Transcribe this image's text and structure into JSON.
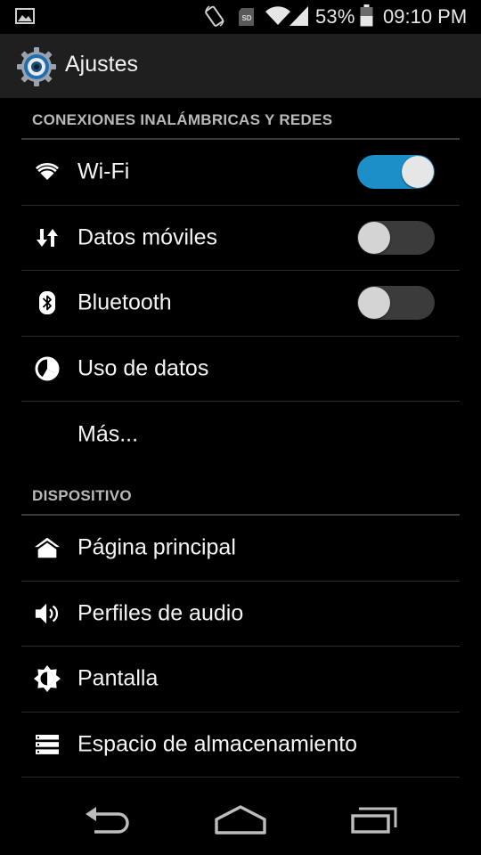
{
  "status_bar": {
    "battery": "53%",
    "time": "09:10 PM",
    "icons": [
      "gallery-icon",
      "rotate-icon",
      "sd-card-icon",
      "wifi-icon",
      "signal-icon",
      "battery-icon"
    ]
  },
  "action_bar": {
    "title": "Ajustes",
    "icon": "settings-gear-icon"
  },
  "sections": [
    {
      "title": "CONEXIONES INALÁMBRICAS Y REDES",
      "items": [
        {
          "label": "Wi-Fi",
          "icon": "wifi-icon",
          "toggle": "on"
        },
        {
          "label": "Datos móviles",
          "icon": "data-arrows-icon",
          "toggle": "off"
        },
        {
          "label": "Bluetooth",
          "icon": "bluetooth-icon",
          "toggle": "off"
        },
        {
          "label": "Uso de datos",
          "icon": "data-usage-icon"
        },
        {
          "label": "Más..."
        }
      ]
    },
    {
      "title": "DISPOSITIVO",
      "items": [
        {
          "label": "Página principal",
          "icon": "home-icon"
        },
        {
          "label": "Perfiles de audio",
          "icon": "speaker-icon"
        },
        {
          "label": "Pantalla",
          "icon": "brightness-icon"
        },
        {
          "label": "Espacio de almacenamiento",
          "icon": "storage-icon"
        }
      ]
    }
  ],
  "colors": {
    "accent": "#1d8fc8",
    "background": "#000000",
    "action_bar": "#1f1f1f",
    "section_header_text": "#b9b9b9"
  },
  "nav_bar": {
    "buttons": [
      "back-icon",
      "home-outline-icon",
      "recent-apps-icon"
    ]
  }
}
